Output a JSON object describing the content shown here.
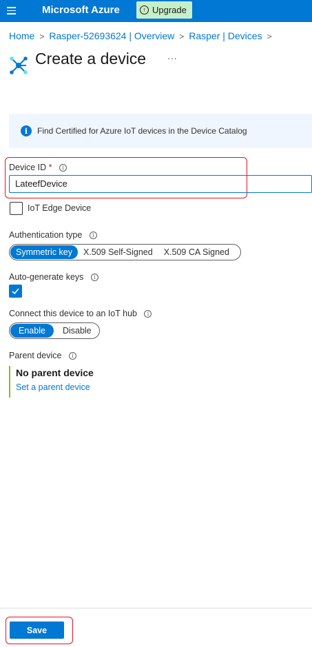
{
  "topbar": {
    "brand": "Microsoft Azure",
    "upgrade_label": "Upgrade",
    "color": "#0078d4"
  },
  "breadcrumb": [
    "Home",
    "Rasper-52693624 | Overview",
    "Rasper | Devices"
  ],
  "page": {
    "title": "Create a device",
    "more_label": "···"
  },
  "info_banner": {
    "text": "Find Certified for Azure IoT devices in the Device Catalog"
  },
  "device_id": {
    "label": "Device ID",
    "required_marker": "*",
    "value": "LateefDevice"
  },
  "iot_edge": {
    "label": "IoT Edge Device",
    "checked": false
  },
  "auth_type": {
    "label": "Authentication type",
    "options": [
      "Symmetric key",
      "X.509 Self-Signed",
      "X.509 CA Signed"
    ],
    "selected": "Symmetric key"
  },
  "auto_generate": {
    "label": "Auto-generate keys",
    "checked": true
  },
  "connect_hub": {
    "label": "Connect this device to an IoT hub",
    "options": [
      "Enable",
      "Disable"
    ],
    "selected": "Enable"
  },
  "parent_device": {
    "label": "Parent device",
    "value": "No parent device",
    "link": "Set a parent device"
  },
  "footer": {
    "save_label": "Save"
  },
  "colors": {
    "accent": "#0078d4",
    "highlight": "#e81123",
    "upgrade_bg": "#c8f0c8",
    "parent_border": "#8cbd18"
  }
}
